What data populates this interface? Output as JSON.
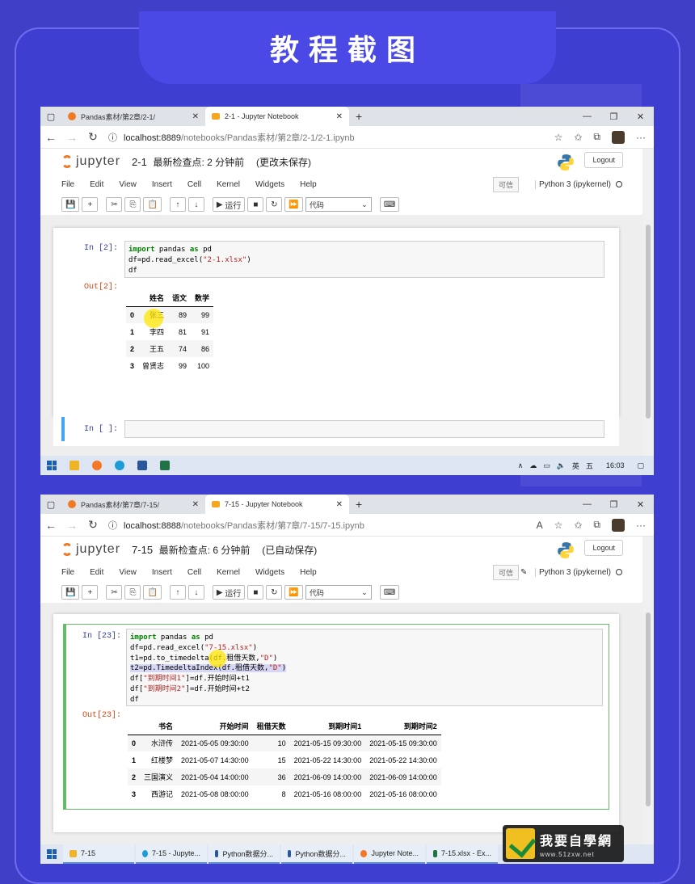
{
  "banner_title": "教程截图",
  "top": {
    "tabs": [
      {
        "label": "Pandas素材/第2章/2-1/",
        "active": false
      },
      {
        "label": "2-1 - Jupyter Notebook",
        "active": true
      }
    ],
    "url_host": "localhost:8889",
    "url_path": "/notebooks/Pandas素材/第2章/2-1/2-1.ipynb",
    "jupyter_word": "jupyter",
    "nb_name": "2-1",
    "checkpoint": "最新检查点: 2 分钟前",
    "save_status": "(更改未保存)",
    "logout": "Logout",
    "menu": [
      "File",
      "Edit",
      "View",
      "Insert",
      "Cell",
      "Kernel",
      "Widgets",
      "Help"
    ],
    "trusted": "可信",
    "kernel": "Python 3 (ipykernel)",
    "run_label": "运行",
    "cell_type": "代码",
    "in_prompt": "In [2]:",
    "out_prompt": "Out[2]:",
    "code": [
      "import pandas as pd",
      "df=pd.read_excel(\"2-1.xlsx\")",
      "df"
    ],
    "table": {
      "columns": [
        "",
        "姓名",
        "语文",
        "数学"
      ],
      "rows": [
        [
          "0",
          "张三",
          "89",
          "99"
        ],
        [
          "1",
          "李四",
          "81",
          "91"
        ],
        [
          "2",
          "王五",
          "74",
          "86"
        ],
        [
          "3",
          "曾贤志",
          "99",
          "100"
        ]
      ]
    },
    "empty_prompt": "In [ ]:",
    "taskbar": {
      "ime": "英",
      "ime2": "五",
      "clock": "16:03"
    }
  },
  "bottom": {
    "tabs": [
      {
        "label": "Pandas素材/第7章/7-15/",
        "active": false
      },
      {
        "label": "7-15 - Jupyter Notebook",
        "active": true
      }
    ],
    "url_host": "localhost:8888",
    "url_path": "/notebooks/Pandas素材/第7章/7-15/7-15.ipynb",
    "jupyter_word": "jupyter",
    "nb_name": "7-15",
    "checkpoint": "最新检查点: 6 分钟前",
    "save_status": "(已自动保存)",
    "logout": "Logout",
    "menu": [
      "File",
      "Edit",
      "View",
      "Insert",
      "Cell",
      "Kernel",
      "Widgets",
      "Help"
    ],
    "trusted": "可信",
    "kernel": "Python 3 (ipykernel)",
    "run_label": "运行",
    "cell_type": "代码",
    "in_prompt": "In [23]:",
    "out_prompt": "Out[23]:",
    "code": [
      "import pandas as pd",
      "df=pd.read_excel(\"7-15.xlsx\")",
      "t1=pd.to_timedelta(df.租借天数,\"D\")",
      "t2=pd.TimedeltaIndex(df.租借天数,\"D\")",
      "df[\"到期时间1\"]=df.开始时间+t1",
      "df[\"到期时间2\"]=df.开始时间+t2",
      "df"
    ],
    "table": {
      "columns": [
        "",
        "书名",
        "开始时间",
        "租借天数",
        "到期时间1",
        "到期时间2"
      ],
      "rows": [
        [
          "0",
          "水浒传",
          "2021-05-05 09:30:00",
          "10",
          "2021-05-15 09:30:00",
          "2021-05-15 09:30:00"
        ],
        [
          "1",
          "红楼梦",
          "2021-05-07 14:30:00",
          "15",
          "2021-05-22 14:30:00",
          "2021-05-22 14:30:00"
        ],
        [
          "2",
          "三国演义",
          "2021-05-04 14:00:00",
          "36",
          "2021-06-09 14:00:00",
          "2021-06-09 14:00:00"
        ],
        [
          "3",
          "西游记",
          "2021-05-08 08:00:00",
          "8",
          "2021-05-16 08:00:00",
          "2021-05-16 08:00:00"
        ]
      ]
    },
    "taskbar_tasks": [
      "7-15",
      "7-15 - Jupyte...",
      "Python数据分...",
      "Python数据分...",
      "Jupyter Note...",
      "7-15.xlsx - Ex..."
    ]
  },
  "watermark": {
    "text": "我要自學網",
    "url": "www.51zxw.net"
  }
}
